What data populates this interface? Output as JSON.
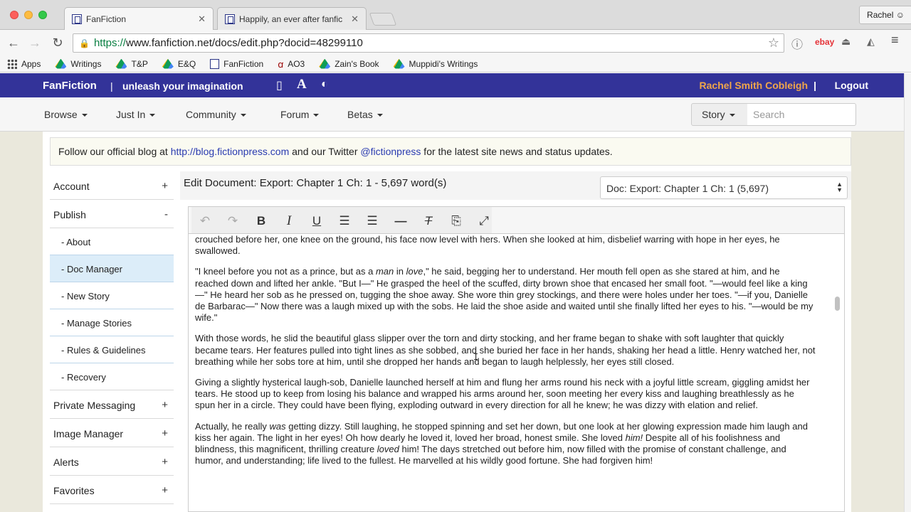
{
  "browser": {
    "tabs": [
      {
        "title": "FanFiction",
        "active": true
      },
      {
        "title": "Happily, an ever after fanfic",
        "active": false
      }
    ],
    "profile_name": "Rachel",
    "url_scheme": "https://",
    "url_rest": "www.fanfiction.net/docs/edit.php?docid=48299110",
    "bookmarks": [
      {
        "label": "Apps",
        "icon": "apps-icon"
      },
      {
        "label": "Writings",
        "icon": "drive-icon"
      },
      {
        "label": "T&P",
        "icon": "drive-icon"
      },
      {
        "label": "E&Q",
        "icon": "drive-icon"
      },
      {
        "label": "FanFiction",
        "icon": "fanfiction-icon"
      },
      {
        "label": "AO3",
        "icon": "ao3-icon"
      },
      {
        "label": "Zain's Book",
        "icon": "drive-icon"
      },
      {
        "label": "Muppidi's Writings",
        "icon": "drive-icon"
      }
    ],
    "ext_ebay": "ebay"
  },
  "site": {
    "brand": "FanFiction",
    "separator": "|",
    "tagline": "unleash your imagination",
    "user_name": "Rachel Smith Cobleigh",
    "pipe": "|",
    "logout": "Logout",
    "colors": {
      "topbar": "#333399",
      "user": "#f0a64a"
    }
  },
  "menu": {
    "items": [
      "Browse",
      "Just In",
      "Community",
      "Forum",
      "Betas"
    ],
    "story_button": "Story",
    "search_placeholder": "Search"
  },
  "notice": {
    "text_before": "Follow our official blog at ",
    "blog_link": "http://blog.fictionpress.com",
    "text_middle": " and our Twitter ",
    "twitter_link": "@fictionpress",
    "text_after": " for the latest site news and status updates."
  },
  "sidebar": {
    "account": "Account",
    "account_toggle": "+",
    "publish": "Publish",
    "publish_toggle": "-",
    "publish_items": [
      "- About",
      "- Doc Manager",
      "- New Story",
      "- Manage Stories",
      "- Rules & Guidelines",
      "- Recovery"
    ],
    "active_item": "- Doc Manager",
    "private_messaging": "Private Messaging",
    "image_manager": "Image Manager",
    "alerts": "Alerts",
    "favorites": "Favorites",
    "plus": "+"
  },
  "editor": {
    "title": "Edit Document: Export: Chapter 1 Ch: 1 - 5,697 word(s)",
    "doc_select_value": "Doc: Export: Chapter 1 Ch: 1 (5,697)",
    "toolbar": [
      "undo-icon",
      "redo-icon",
      "bold-icon",
      "italic-icon",
      "underline-icon",
      "align-left-icon",
      "align-center-icon",
      "horizontal-rule-icon",
      "clear-format-icon",
      "paste-icon",
      "fullscreen-icon"
    ],
    "paragraphs": [
      "crouched before her, one knee on the ground, his face now level with hers. When she looked at him, disbelief warring with hope in her eyes, he swallowed.",
      "\"I kneel before you not as a prince, but as a |man| in |love|,\" he said, begging her to understand. Her mouth fell open as she stared at him, and he reached down and lifted her ankle. \"But I—\" He grasped the heel of the scuffed, dirty brown shoe that encased her small foot. \"—would feel like a king—\" He heard her sob as he pressed on, tugging the shoe away. She wore thin grey stockings, and there were holes under her toes. \"—if you, Danielle de Barbarac—\" Now there was a laugh mixed up with the sobs. He laid the shoe aside and waited until she finally lifted her eyes to his. \"—would be my wife.\"",
      "With those words, he slid the beautiful glass slipper over the torn and dirty stocking, and her frame began to shake with soft laughter that quickly became tears. Her features pulled into tight lines as she sobbed, and she buried her face in her hands, shaking her head a little. Henry watched her, not breathing while her sobs tore at him, until she dropped her hands and began to laugh helplessly, her eyes still closed.",
      "Giving a slightly hysterical laugh-sob, Danielle launched herself at him and flung her arms round his neck with a joyful little scream, giggling amidst her tears. He stood up to keep from losing his balance and wrapped his arms around her, soon meeting her every kiss and laughing breathlessly as he spun her in a circle. They could have been flying, exploding outward in every direction for all he knew; he was dizzy with elation and relief.",
      "Actually, he really |was| getting dizzy. Still laughing, he stopped spinning and set her down, but one look at her glowing expression made him laugh and kiss her again. The light in her eyes! Oh how dearly he loved it, loved her broad, honest smile. She loved |him!| Despite all of his foolishness and blindness, this magnificent, thrilling creature |loved| him! The days stretched out before him, now filled with the promise of constant challenge, and humor, and understanding; life lived to the fullest. He marvelled at his wildly good fortune. She had forgiven him!"
    ]
  }
}
